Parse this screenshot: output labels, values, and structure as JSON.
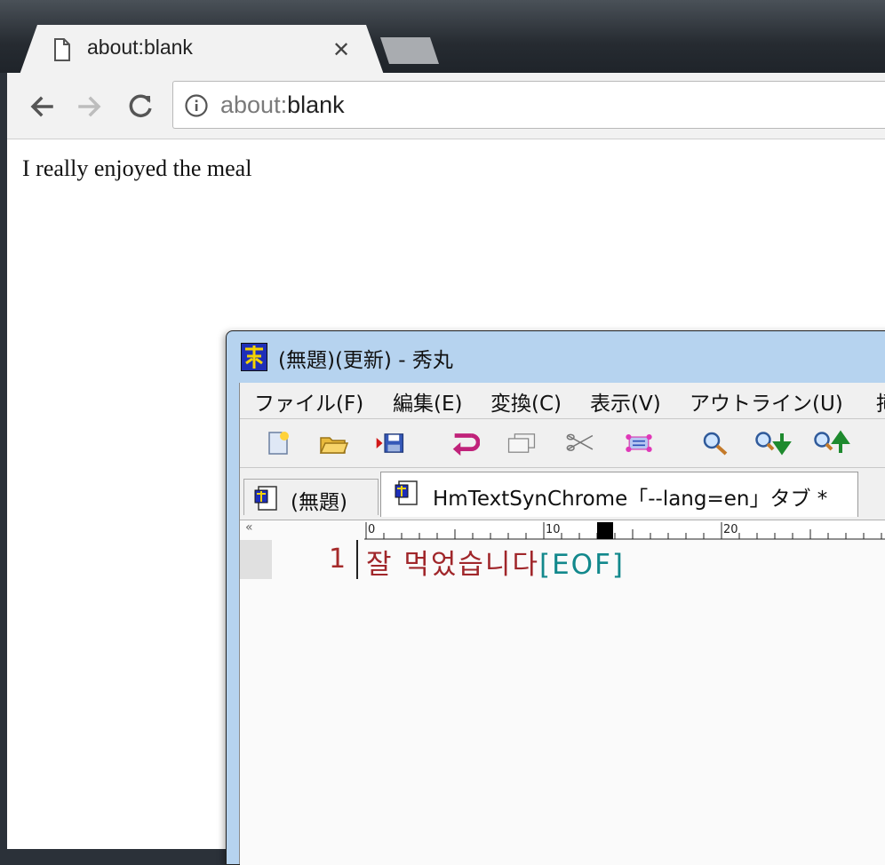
{
  "browser": {
    "tab_title": "about:blank",
    "url_scheme": "about:",
    "url_host": "blank",
    "page_text": "I really enjoyed the meal"
  },
  "editor": {
    "window_title": "(無題)(更新) - 秀丸",
    "menu": [
      "ファイル(F)",
      "編集(E)",
      "変換(C)",
      "表示(V)",
      "アウトライン(U)",
      "挿"
    ],
    "tabs": [
      {
        "label": "(無題)"
      },
      {
        "label": "HmTextSynChrome「--lang=en」タブ *"
      }
    ],
    "ruler_marks": [
      "0",
      "10",
      "20"
    ],
    "line_number": "1",
    "line_text": "잘 먹었습니다",
    "eof_marker": "[EOF]"
  },
  "colors": {
    "text_red": "#a0262a",
    "eof_teal": "#12888c",
    "title_bar_blue": "#b6d3ef"
  },
  "icons": [
    "page-icon",
    "close-icon",
    "back-arrow-icon",
    "forward-arrow-icon",
    "reload-icon",
    "info-icon",
    "new-file-icon",
    "open-folder-icon",
    "save-icon",
    "undo-icon",
    "copy-icon",
    "cut-icon",
    "paste-icon",
    "search-icon",
    "search-next-icon",
    "search-prev-icon",
    "document-icon"
  ]
}
